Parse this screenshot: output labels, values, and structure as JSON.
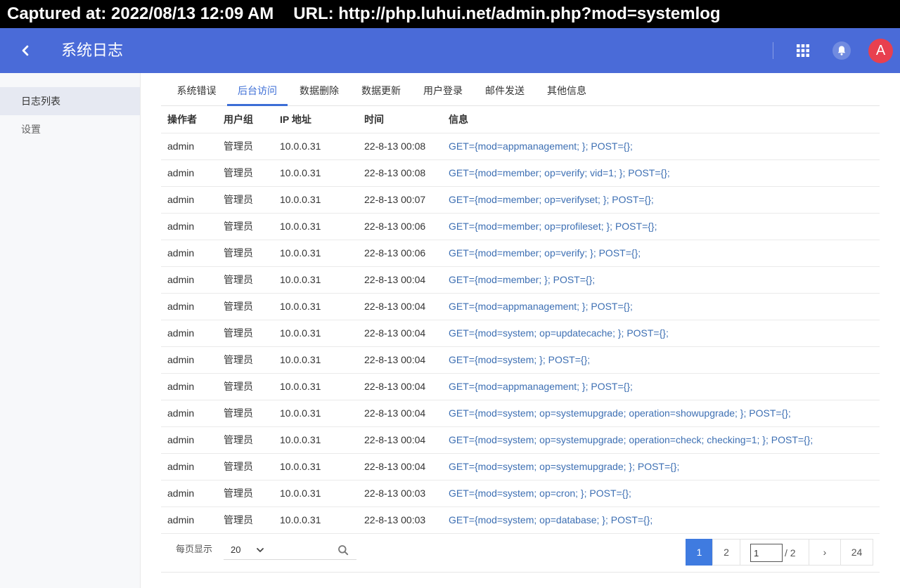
{
  "capture": {
    "timestamp": "Captured at: 2022/08/13 12:09 AM",
    "url": "URL: http://php.luhui.net/admin.php?mod=systemlog"
  },
  "header": {
    "title": "系统日志",
    "avatar_letter": "A",
    "bg_color": "#4a6bd8",
    "avatar_color": "#e8404f"
  },
  "sidebar": {
    "items": [
      {
        "label": "日志列表"
      },
      {
        "label": "设置"
      }
    ]
  },
  "tabs": [
    {
      "label": "系统错误"
    },
    {
      "label": "后台访问"
    },
    {
      "label": "数据删除"
    },
    {
      "label": "数据更新"
    },
    {
      "label": "用户登录"
    },
    {
      "label": "邮件发送"
    },
    {
      "label": "其他信息"
    }
  ],
  "table": {
    "headers": [
      "操作者",
      "用户组",
      "IP 地址",
      "时间",
      "信息"
    ],
    "rows": [
      [
        "admin",
        "管理员",
        "10.0.0.31",
        "22-8-13 00:08",
        "GET={mod=appmanagement; }; POST={};"
      ],
      [
        "admin",
        "管理员",
        "10.0.0.31",
        "22-8-13 00:08",
        "GET={mod=member; op=verify; vid=1; }; POST={};"
      ],
      [
        "admin",
        "管理员",
        "10.0.0.31",
        "22-8-13 00:07",
        "GET={mod=member; op=verifyset; }; POST={};"
      ],
      [
        "admin",
        "管理员",
        "10.0.0.31",
        "22-8-13 00:06",
        "GET={mod=member; op=profileset; }; POST={};"
      ],
      [
        "admin",
        "管理员",
        "10.0.0.31",
        "22-8-13 00:06",
        "GET={mod=member; op=verify; }; POST={};"
      ],
      [
        "admin",
        "管理员",
        "10.0.0.31",
        "22-8-13 00:04",
        "GET={mod=member; }; POST={};"
      ],
      [
        "admin",
        "管理员",
        "10.0.0.31",
        "22-8-13 00:04",
        "GET={mod=appmanagement; }; POST={};"
      ],
      [
        "admin",
        "管理员",
        "10.0.0.31",
        "22-8-13 00:04",
        "GET={mod=system; op=updatecache; }; POST={};"
      ],
      [
        "admin",
        "管理员",
        "10.0.0.31",
        "22-8-13 00:04",
        "GET={mod=system; }; POST={};"
      ],
      [
        "admin",
        "管理员",
        "10.0.0.31",
        "22-8-13 00:04",
        "GET={mod=appmanagement; }; POST={};"
      ],
      [
        "admin",
        "管理员",
        "10.0.0.31",
        "22-8-13 00:04",
        "GET={mod=system; op=systemupgrade; operation=showupgrade; }; POST={};"
      ],
      [
        "admin",
        "管理员",
        "10.0.0.31",
        "22-8-13 00:04",
        "GET={mod=system; op=systemupgrade; operation=check; checking=1; }; POST={};"
      ],
      [
        "admin",
        "管理员",
        "10.0.0.31",
        "22-8-13 00:04",
        "GET={mod=system; op=systemupgrade; }; POST={};"
      ],
      [
        "admin",
        "管理员",
        "10.0.0.31",
        "22-8-13 00:03",
        "GET={mod=system; op=cron; }; POST={};"
      ],
      [
        "admin",
        "管理员",
        "10.0.0.31",
        "22-8-13 00:03",
        "GET={mod=system; op=database; }; POST={};"
      ]
    ]
  },
  "pagination": {
    "per_page_label": "每页显示",
    "per_page_value": "20",
    "page_1": "1",
    "page_2": "2",
    "current_input": "1",
    "total_label": "/ 2",
    "next": "›",
    "last": "24"
  }
}
